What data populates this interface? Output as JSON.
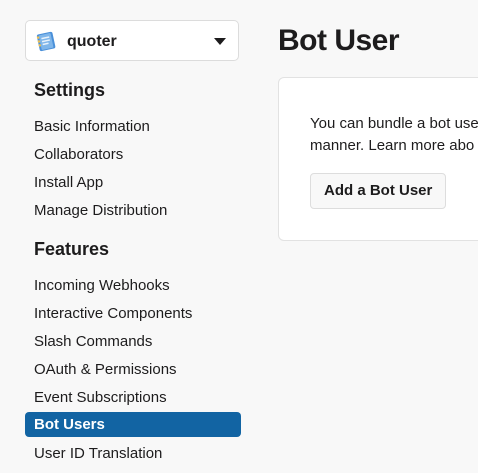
{
  "app_selector": {
    "app_name": "quoter",
    "icon": "notebook-app-icon",
    "dropdown_icon": "caret-down-icon"
  },
  "sidebar": {
    "settings_heading": "Settings",
    "settings_items": [
      {
        "label": "Basic Information"
      },
      {
        "label": "Collaborators"
      },
      {
        "label": "Install App"
      },
      {
        "label": "Manage Distribution"
      }
    ],
    "features_heading": "Features",
    "features_items": [
      {
        "label": "Incoming Webhooks"
      },
      {
        "label": "Interactive Components"
      },
      {
        "label": "Slash Commands"
      },
      {
        "label": "OAuth & Permissions"
      },
      {
        "label": "Event Subscriptions"
      },
      {
        "label": "Bot Users",
        "active": true
      },
      {
        "label": "User ID Translation"
      }
    ]
  },
  "main": {
    "title": "Bot User",
    "card": {
      "line1": "You can bundle a bot use",
      "line2_text": "manner. ",
      "line2_link": "Learn more abo",
      "add_button_label": "Add a Bot User"
    }
  },
  "colors": {
    "active_nav": "#1264a3",
    "background": "#f8f8f8",
    "text": "#1d1c1d"
  }
}
